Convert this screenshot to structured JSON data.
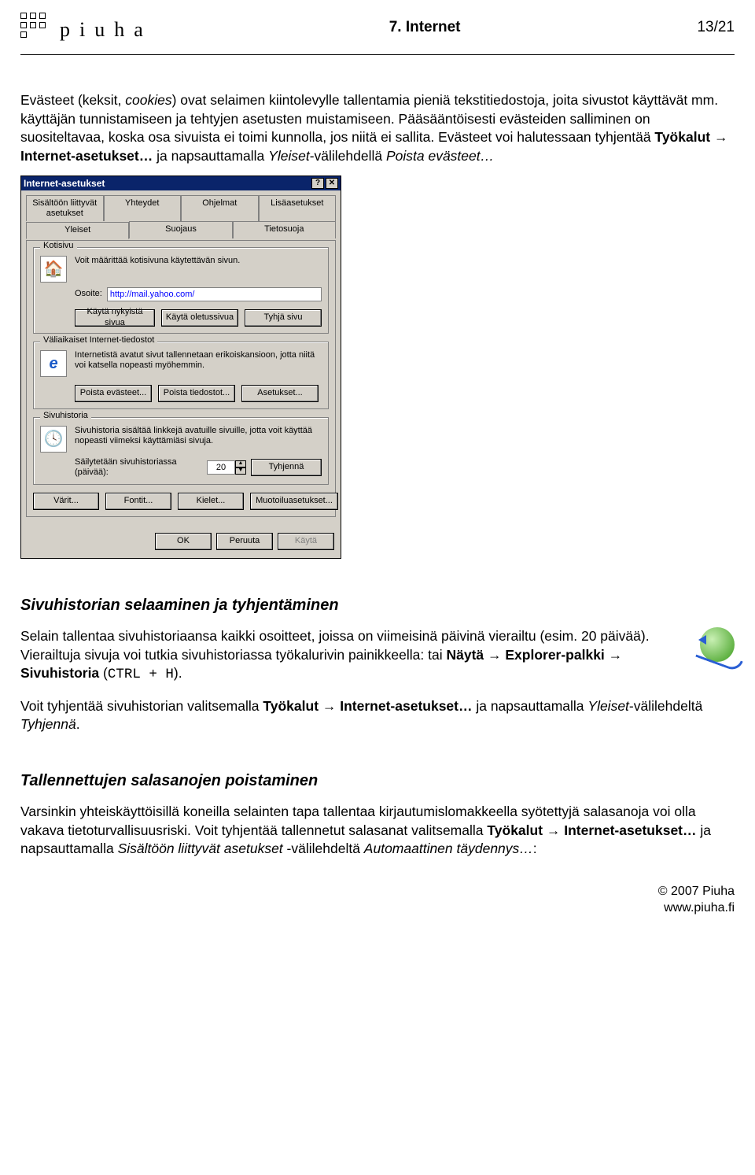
{
  "header": {
    "logo_text": "piuha",
    "section_title": "7. Internet",
    "page_counter": "13/21"
  },
  "para1_pre": "Evästeet (keksit, ",
  "para1_cookies": "cookies",
  "para1_mid1": ") ovat selaimen kiintolevylle tallentamia pieniä tekstitiedostoja, joita sivustot käyttävät mm. käyttäjän tunnistamiseen ja tehtyjen asetusten muistamiseen. Pääsääntöisesti evästeiden salliminen on suositeltavaa, koska osa sivuista ei toimi kunnolla, jos niitä ei sallita. Evästeet voi halutessaan tyhjentää ",
  "para1_bold": "Työkalut → Internet-asetukset…",
  "para1_mid2": " ja napsauttamalla ",
  "para1_it1": "Yleiset",
  "para1_mid3": "-välilehdellä ",
  "para1_it2": "Poista evästeet…",
  "dialog": {
    "title": "Internet-asetukset",
    "help": "?",
    "close": "✕",
    "tabs_row1": [
      "Sisältöön liittyvät asetukset",
      "Yhteydet",
      "Ohjelmat",
      "Lisäasetukset"
    ],
    "tabs_row2": [
      "Yleiset",
      "Suojaus",
      "Tietosuoja"
    ],
    "group_home": {
      "legend": "Kotisivu",
      "desc": "Voit määrittää kotisivuna käytettävän sivun.",
      "label": "Osoite:",
      "value": "http://mail.yahoo.com/",
      "icon": "🏠",
      "btn1": "Käytä nykyistä sivua",
      "btn2": "Käytä oletussivua",
      "btn3": "Tyhjä sivu"
    },
    "group_temp": {
      "legend": "Väliaikaiset Internet-tiedostot",
      "desc": "Internetistä avatut sivut tallennetaan erikoiskansioon, jotta niitä voi katsella nopeasti myöhemmin.",
      "icon": "e",
      "btn1": "Poista evästeet...",
      "btn2": "Poista tiedostot...",
      "btn3": "Asetukset..."
    },
    "group_hist": {
      "legend": "Sivuhistoria",
      "desc": "Sivuhistoria sisältää linkkejä avatuille sivuille, jotta voit käyttää nopeasti viimeksi käyttämiäsi sivuja.",
      "icon": "🕓",
      "label": "Säilytetään sivuhistoriassa (päivää):",
      "value": "20",
      "btn": "Tyhjennä"
    },
    "bottom_row": [
      "Värit...",
      "Fontit...",
      "Kielet...",
      "Muotoiluasetukset..."
    ],
    "ok": "OK",
    "cancel": "Peruuta",
    "apply": "Käytä"
  },
  "section2": {
    "title": "Sivuhistorian selaaminen ja tyhjentäminen",
    "p1_a": "Selain tallentaa sivuhistoriaansa kaikki osoitteet, joissa on viimeisinä päivinä vierailtu (esim. 20 päivää). Vierailtuja sivuja voi tutkia sivuhistoriassa työkalurivin painikkeella: tai ",
    "p1_bold": "Näytä → Explorer-palkki → Sivuhistoria",
    "p1_b": " (",
    "p1_mono": "CTRL + H",
    "p1_c": ").",
    "p2_a": "Voit tyhjentää sivuhistorian valitsemalla ",
    "p2_bold": "Työkalut → Internet-asetukset…",
    "p2_b": " ja napsauttamalla ",
    "p2_it1": "Yleiset",
    "p2_c": "-välilehdeltä ",
    "p2_it2": "Tyhjennä",
    "p2_d": "."
  },
  "section3": {
    "title": "Tallennettujen salasanojen poistaminen",
    "p1_a": "Varsinkin yhteiskäyttöisillä koneilla selainten tapa tallentaa kirjautumislomakkeella syötettyjä salasanoja voi olla vakava tietoturvallisuusriski. Voit tyhjentää tallennetut salasanat valitsemalla ",
    "p1_bold": "Työkalut → Internet-asetukset…",
    "p1_b": " ja napsauttamalla ",
    "p1_it1": "Sisältöön liittyvät asetukset",
    "p1_c": " -välilehdeltä ",
    "p1_it2": "Automaattinen täydennys…",
    "p1_d": ":"
  },
  "footer": {
    "line1": "© 2007 Piuha",
    "line2": "www.piuha.fi"
  }
}
